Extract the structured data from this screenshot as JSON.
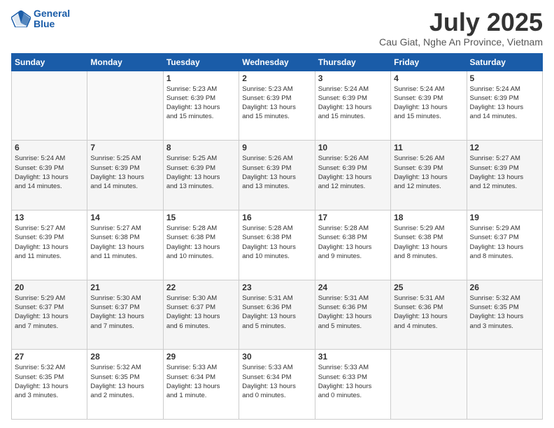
{
  "header": {
    "logo_line1": "General",
    "logo_line2": "Blue",
    "title": "July 2025",
    "subtitle": "Cau Giat, Nghe An Province, Vietnam"
  },
  "days_of_week": [
    "Sunday",
    "Monday",
    "Tuesday",
    "Wednesday",
    "Thursday",
    "Friday",
    "Saturday"
  ],
  "weeks": [
    [
      {
        "day": "",
        "info": ""
      },
      {
        "day": "",
        "info": ""
      },
      {
        "day": "1",
        "info": "Sunrise: 5:23 AM\nSunset: 6:39 PM\nDaylight: 13 hours\nand 15 minutes."
      },
      {
        "day": "2",
        "info": "Sunrise: 5:23 AM\nSunset: 6:39 PM\nDaylight: 13 hours\nand 15 minutes."
      },
      {
        "day": "3",
        "info": "Sunrise: 5:24 AM\nSunset: 6:39 PM\nDaylight: 13 hours\nand 15 minutes."
      },
      {
        "day": "4",
        "info": "Sunrise: 5:24 AM\nSunset: 6:39 PM\nDaylight: 13 hours\nand 15 minutes."
      },
      {
        "day": "5",
        "info": "Sunrise: 5:24 AM\nSunset: 6:39 PM\nDaylight: 13 hours\nand 14 minutes."
      }
    ],
    [
      {
        "day": "6",
        "info": "Sunrise: 5:24 AM\nSunset: 6:39 PM\nDaylight: 13 hours\nand 14 minutes."
      },
      {
        "day": "7",
        "info": "Sunrise: 5:25 AM\nSunset: 6:39 PM\nDaylight: 13 hours\nand 14 minutes."
      },
      {
        "day": "8",
        "info": "Sunrise: 5:25 AM\nSunset: 6:39 PM\nDaylight: 13 hours\nand 13 minutes."
      },
      {
        "day": "9",
        "info": "Sunrise: 5:26 AM\nSunset: 6:39 PM\nDaylight: 13 hours\nand 13 minutes."
      },
      {
        "day": "10",
        "info": "Sunrise: 5:26 AM\nSunset: 6:39 PM\nDaylight: 13 hours\nand 12 minutes."
      },
      {
        "day": "11",
        "info": "Sunrise: 5:26 AM\nSunset: 6:39 PM\nDaylight: 13 hours\nand 12 minutes."
      },
      {
        "day": "12",
        "info": "Sunrise: 5:27 AM\nSunset: 6:39 PM\nDaylight: 13 hours\nand 12 minutes."
      }
    ],
    [
      {
        "day": "13",
        "info": "Sunrise: 5:27 AM\nSunset: 6:39 PM\nDaylight: 13 hours\nand 11 minutes."
      },
      {
        "day": "14",
        "info": "Sunrise: 5:27 AM\nSunset: 6:38 PM\nDaylight: 13 hours\nand 11 minutes."
      },
      {
        "day": "15",
        "info": "Sunrise: 5:28 AM\nSunset: 6:38 PM\nDaylight: 13 hours\nand 10 minutes."
      },
      {
        "day": "16",
        "info": "Sunrise: 5:28 AM\nSunset: 6:38 PM\nDaylight: 13 hours\nand 10 minutes."
      },
      {
        "day": "17",
        "info": "Sunrise: 5:28 AM\nSunset: 6:38 PM\nDaylight: 13 hours\nand 9 minutes."
      },
      {
        "day": "18",
        "info": "Sunrise: 5:29 AM\nSunset: 6:38 PM\nDaylight: 13 hours\nand 8 minutes."
      },
      {
        "day": "19",
        "info": "Sunrise: 5:29 AM\nSunset: 6:37 PM\nDaylight: 13 hours\nand 8 minutes."
      }
    ],
    [
      {
        "day": "20",
        "info": "Sunrise: 5:29 AM\nSunset: 6:37 PM\nDaylight: 13 hours\nand 7 minutes."
      },
      {
        "day": "21",
        "info": "Sunrise: 5:30 AM\nSunset: 6:37 PM\nDaylight: 13 hours\nand 7 minutes."
      },
      {
        "day": "22",
        "info": "Sunrise: 5:30 AM\nSunset: 6:37 PM\nDaylight: 13 hours\nand 6 minutes."
      },
      {
        "day": "23",
        "info": "Sunrise: 5:31 AM\nSunset: 6:36 PM\nDaylight: 13 hours\nand 5 minutes."
      },
      {
        "day": "24",
        "info": "Sunrise: 5:31 AM\nSunset: 6:36 PM\nDaylight: 13 hours\nand 5 minutes."
      },
      {
        "day": "25",
        "info": "Sunrise: 5:31 AM\nSunset: 6:36 PM\nDaylight: 13 hours\nand 4 minutes."
      },
      {
        "day": "26",
        "info": "Sunrise: 5:32 AM\nSunset: 6:35 PM\nDaylight: 13 hours\nand 3 minutes."
      }
    ],
    [
      {
        "day": "27",
        "info": "Sunrise: 5:32 AM\nSunset: 6:35 PM\nDaylight: 13 hours\nand 3 minutes."
      },
      {
        "day": "28",
        "info": "Sunrise: 5:32 AM\nSunset: 6:35 PM\nDaylight: 13 hours\nand 2 minutes."
      },
      {
        "day": "29",
        "info": "Sunrise: 5:33 AM\nSunset: 6:34 PM\nDaylight: 13 hours\nand 1 minute."
      },
      {
        "day": "30",
        "info": "Sunrise: 5:33 AM\nSunset: 6:34 PM\nDaylight: 13 hours\nand 0 minutes."
      },
      {
        "day": "31",
        "info": "Sunrise: 5:33 AM\nSunset: 6:33 PM\nDaylight: 13 hours\nand 0 minutes."
      },
      {
        "day": "",
        "info": ""
      },
      {
        "day": "",
        "info": ""
      }
    ]
  ]
}
